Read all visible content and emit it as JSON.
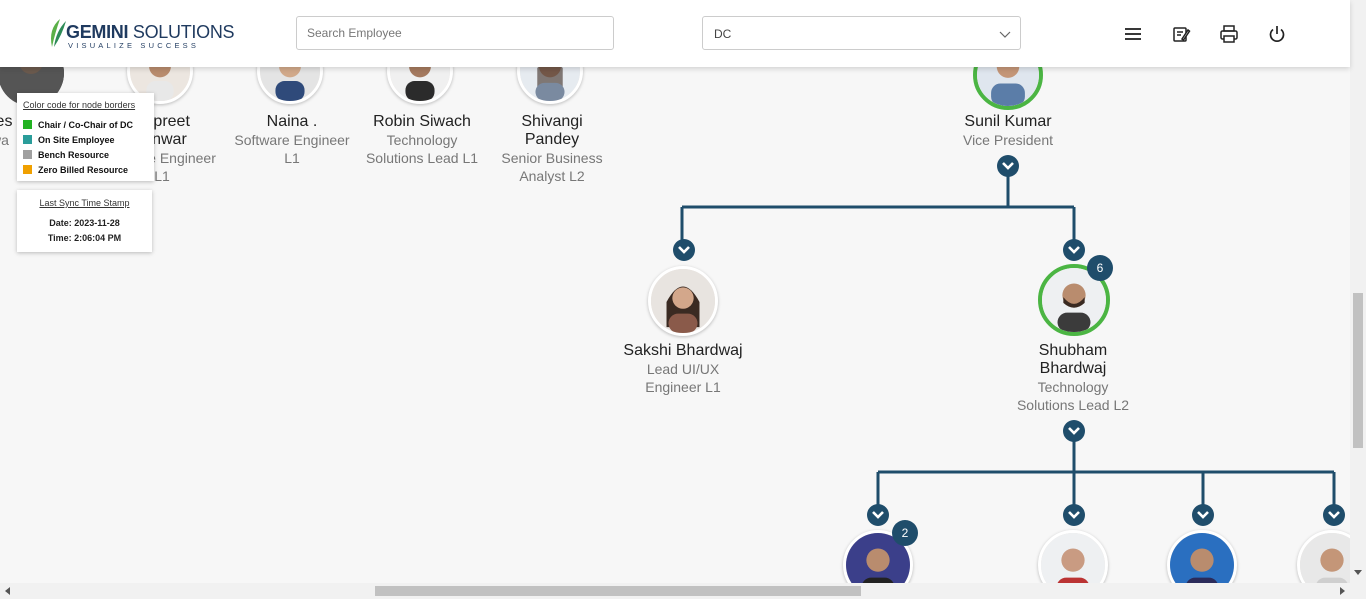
{
  "header": {
    "logo": {
      "brand_bold": "GEMINI",
      "brand_rest": " SOLUTIONS",
      "tagline": "VISUALIZE SUCCESS"
    },
    "search": {
      "placeholder": "Search Employee",
      "value": ""
    },
    "department_select": {
      "value": "DC"
    },
    "icons": [
      "menu-icon",
      "edit-note-icon",
      "print-icon",
      "power-icon"
    ]
  },
  "legend": {
    "title": "Color code for node borders",
    "items": [
      {
        "label": "Chair / Co-Chair of DC",
        "color": "#22b222"
      },
      {
        "label": "On Site Employee",
        "color": "#2a9d9a"
      },
      {
        "label": "Bench Resource",
        "color": "#a0a0a0"
      },
      {
        "label": "Zero Billed Resource",
        "color": "#f0a000"
      }
    ]
  },
  "sync": {
    "title": "Last Sync Time Stamp",
    "date_label": "Date: 2023-11-28",
    "time_label": "Time: 2:06:04 PM"
  },
  "nodes": {
    "partial_left": {
      "name": "ves",
      "title": "wa"
    },
    "jaspreet": {
      "name_l1": "mpreet",
      "name_l2": "anwar",
      "title_l1": "e Engineer",
      "title_l2": "L1"
    },
    "naina": {
      "name": "Naina .",
      "title_l1": "Software Engineer",
      "title_l2": "L1"
    },
    "robin": {
      "name": "Robin Siwach",
      "title_l1": "Technology",
      "title_l2": "Solutions Lead L1"
    },
    "shivangi": {
      "name_l1": "Shivangi",
      "name_l2": "Pandey",
      "title_l1": "Senior Business",
      "title_l2": "Analyst L2"
    },
    "sunil": {
      "name": "Sunil Kumar",
      "title": "Vice President"
    },
    "sakshi": {
      "name": "Sakshi Bhardwaj",
      "title_l1": "Lead UI/UX",
      "title_l2": "Engineer L1"
    },
    "shubham": {
      "name_l1": "Shubham",
      "name_l2": "Bhardwaj",
      "title_l1": "Technology",
      "title_l2": "Solutions Lead L2",
      "reports_count": "6"
    },
    "child1": {
      "reports_count": "2"
    }
  }
}
